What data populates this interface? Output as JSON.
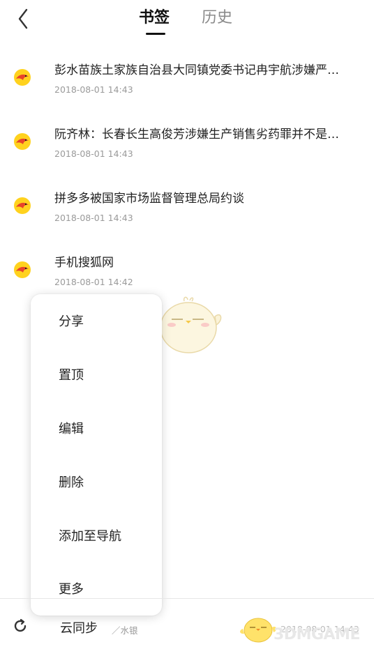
{
  "header": {
    "tab_active": "书签",
    "tab_inactive": "历史"
  },
  "bookmarks": [
    {
      "title": "彭水苗族土家族自治县大同镇党委书记冉宇航涉嫌严…",
      "time": "2018-08-01 14:43",
      "icon": "sohu-fox-icon"
    },
    {
      "title": "阮齐林：长春长生高俊芳涉嫌生产销售劣药罪并不是…",
      "time": "2018-08-01 14:43",
      "icon": "sohu-fox-icon"
    },
    {
      "title": "拼多多被国家市场监督管理总局约谈",
      "time": "2018-08-01 14:43",
      "icon": "sohu-fox-icon"
    },
    {
      "title": "手机搜狐网",
      "time": "2018-08-01 14:42",
      "icon": "sohu-fox-icon"
    }
  ],
  "context_menu": {
    "items": [
      "分享",
      "置顶",
      "编辑",
      "删除",
      "添加至导航",
      "更多"
    ]
  },
  "bottom_bar": {
    "sync_label": "云同步",
    "sync_sub": "／水银",
    "sync_time": "2018-08-01 14:43"
  },
  "watermark": "3DMGAME",
  "colors": {
    "favicon_yellow": "#FFD21E",
    "favicon_red": "#E8432A",
    "text_primary": "#222222",
    "text_secondary": "#9A9A9A"
  }
}
